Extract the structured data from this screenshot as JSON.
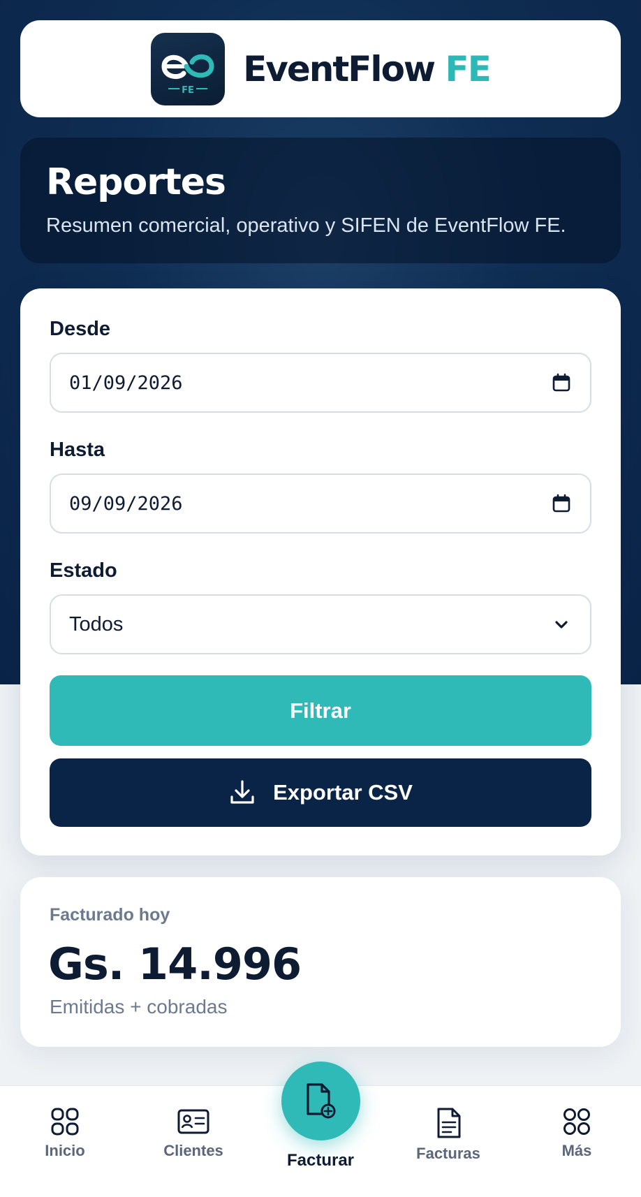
{
  "brand": {
    "name": "EventFlow",
    "accent": "FE",
    "logo_caption": "FE",
    "colors": {
      "navy": "#0a2447",
      "teal": "#2fb9b7"
    }
  },
  "hero": {
    "title": "Reportes",
    "subtitle": "Resumen comercial, operativo y SIFEN de EventFlow FE."
  },
  "filters": {
    "desde": {
      "label": "Desde",
      "value": "01/09/2026",
      "icon": "calendar-icon"
    },
    "hasta": {
      "label": "Hasta",
      "value": "09/09/2026",
      "icon": "calendar-icon"
    },
    "estado": {
      "label": "Estado",
      "selected": "Todos",
      "icon": "chevron-down-icon"
    },
    "filter_button": "Filtrar",
    "export_button": {
      "label": "Exportar CSV",
      "icon": "download-icon"
    }
  },
  "stat": {
    "label": "Facturado hoy",
    "value": "Gs. 14.996",
    "sub": "Emitidas + cobradas"
  },
  "nav": {
    "items": [
      {
        "label": "Inicio",
        "icon": "grid-icon"
      },
      {
        "label": "Clientes",
        "icon": "id-card-icon"
      },
      {
        "label": "Facturar",
        "icon": "new-document-icon",
        "active": true
      },
      {
        "label": "Facturas",
        "icon": "document-icon"
      },
      {
        "label": "Más",
        "icon": "more-icon"
      }
    ]
  }
}
